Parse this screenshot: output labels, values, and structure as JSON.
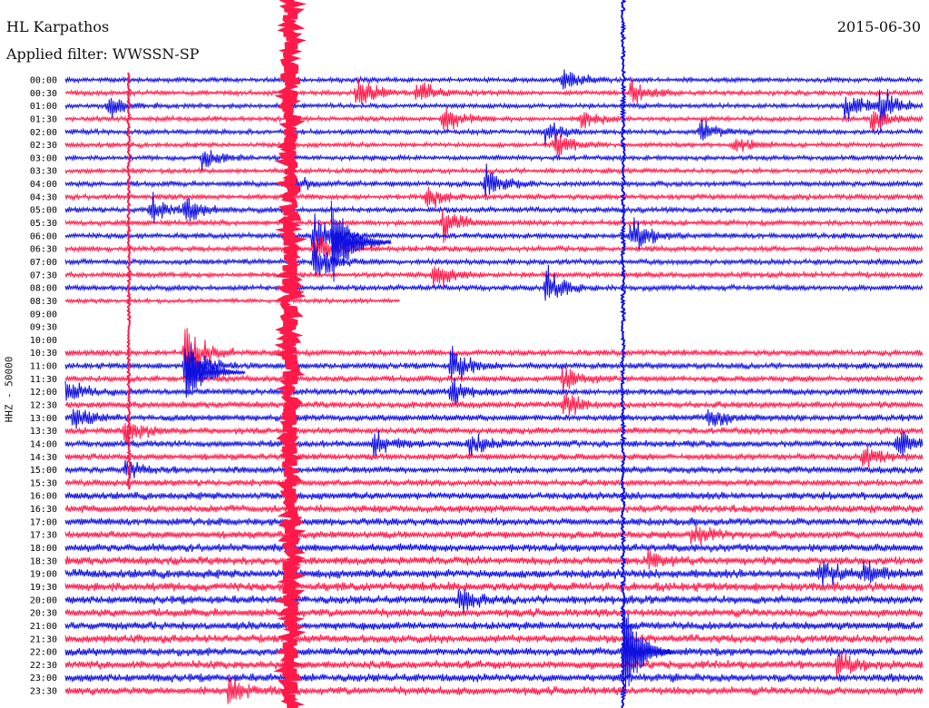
{
  "header": {
    "station": "HL Karpathos",
    "date": "2015-06-30",
    "filter": "Applied filter: WWSSN-SP",
    "channel_label": "HHZ - 50000"
  },
  "chart_data": {
    "type": "line",
    "title": "HL Karpathos",
    "subtitle": "Applied filter: WWSSN-SP",
    "ylabel": "HHZ - 50000",
    "xlabel": "",
    "colors": [
      "#1010e0",
      "#ff1a4a"
    ],
    "color_rule": "rows alternate blue (even index) and red (odd index), starting blue at 00:00",
    "row_labels": [
      "00:00",
      "00:30",
      "01:00",
      "01:30",
      "02:00",
      "02:30",
      "03:00",
      "03:30",
      "04:00",
      "04:30",
      "05:00",
      "05:30",
      "06:00",
      "06:30",
      "07:00",
      "07:30",
      "08:00",
      "08:30",
      "09:00",
      "09:30",
      "10:00",
      "10:30",
      "11:00",
      "11:30",
      "12:00",
      "12:30",
      "13:00",
      "13:30",
      "14:00",
      "14:30",
      "15:00",
      "15:30",
      "16:00",
      "16:30",
      "17:00",
      "17:30",
      "18:00",
      "18:30",
      "19:00",
      "19:30",
      "20:00",
      "20:30",
      "21:00",
      "21:30",
      "22:00",
      "22:30",
      "23:00",
      "23:30"
    ],
    "trace_extent": [
      1,
      1,
      1,
      1,
      1,
      1,
      1,
      1,
      1,
      1,
      1,
      1,
      1,
      1,
      1,
      1,
      1,
      0.39,
      0,
      0,
      0.08,
      1,
      1,
      1,
      1,
      1,
      1,
      1,
      1,
      1,
      1,
      1,
      1,
      1,
      1,
      1,
      1,
      1,
      1,
      1,
      1,
      1,
      1,
      1,
      1,
      1,
      1,
      1
    ],
    "trace_start": [
      0,
      0,
      0,
      0,
      0,
      0,
      0,
      0,
      0,
      0,
      0,
      0,
      0,
      0,
      0,
      0,
      0,
      0,
      0,
      0,
      0.92,
      0,
      0,
      0,
      0,
      0,
      0,
      0,
      0,
      0,
      0,
      0,
      0,
      0,
      0,
      0,
      0,
      0,
      0,
      0,
      0,
      0,
      0,
      0,
      0,
      0,
      0,
      0
    ],
    "noise_level": [
      0.22,
      0.22,
      0.22,
      0.22,
      0.22,
      0.22,
      0.22,
      0.22,
      0.25,
      0.25,
      0.25,
      0.25,
      0.25,
      0.25,
      0.25,
      0.25,
      0.25,
      0.2,
      0,
      0,
      0.12,
      0.28,
      0.28,
      0.28,
      0.3,
      0.3,
      0.3,
      0.3,
      0.3,
      0.3,
      0.3,
      0.3,
      0.35,
      0.35,
      0.35,
      0.35,
      0.38,
      0.38,
      0.42,
      0.42,
      0.38,
      0.38,
      0.38,
      0.38,
      0.38,
      0.38,
      0.38,
      0.38
    ],
    "events": [
      {
        "row": 1,
        "at": 0.34,
        "amp": 1.6
      },
      {
        "row": 1,
        "at": 0.41,
        "amp": 1.2
      },
      {
        "row": 1,
        "at": 0.66,
        "amp": 1.5
      },
      {
        "row": 0,
        "at": 0.58,
        "amp": 1.2
      },
      {
        "row": 2,
        "at": 0.05,
        "amp": 1.3
      },
      {
        "row": 2,
        "at": 0.91,
        "amp": 1.8
      },
      {
        "row": 2,
        "at": 0.95,
        "amp": 2.0
      },
      {
        "row": 3,
        "at": 0.44,
        "amp": 1.4
      },
      {
        "row": 3,
        "at": 0.6,
        "amp": 1.0
      },
      {
        "row": 3,
        "at": 0.94,
        "amp": 1.2
      },
      {
        "row": 4,
        "at": 0.56,
        "amp": 1.3
      },
      {
        "row": 4,
        "at": 0.74,
        "amp": 1.1
      },
      {
        "row": 5,
        "at": 0.57,
        "amp": 1.3
      },
      {
        "row": 5,
        "at": 0.78,
        "amp": 1.0
      },
      {
        "row": 6,
        "at": 0.16,
        "amp": 1.3
      },
      {
        "row": 8,
        "at": 0.26,
        "amp": 1.2
      },
      {
        "row": 8,
        "at": 0.49,
        "amp": 1.6
      },
      {
        "row": 9,
        "at": 0.42,
        "amp": 1.2
      },
      {
        "row": 10,
        "at": 0.1,
        "amp": 1.4
      },
      {
        "row": 10,
        "at": 0.14,
        "amp": 1.2
      },
      {
        "row": 11,
        "at": 0.44,
        "amp": 1.5
      },
      {
        "row": 12,
        "at": 0.29,
        "amp": 2.4
      },
      {
        "row": 12,
        "at": 0.66,
        "amp": 1.8
      },
      {
        "row": 13,
        "at": 0.29,
        "amp": 1.8
      },
      {
        "row": 14,
        "at": 0.29,
        "amp": 1.8
      },
      {
        "row": 15,
        "at": 0.43,
        "amp": 1.4
      },
      {
        "row": 16,
        "at": 0.56,
        "amp": 2.0
      },
      {
        "row": 21,
        "at": 0.14,
        "amp": 3.0
      },
      {
        "row": 22,
        "at": 0.14,
        "amp": 2.6
      },
      {
        "row": 22,
        "at": 0.45,
        "amp": 1.8
      },
      {
        "row": 23,
        "at": 0.58,
        "amp": 1.4
      },
      {
        "row": 24,
        "at": 0.45,
        "amp": 1.4
      },
      {
        "row": 24,
        "at": 0.0,
        "amp": 1.3
      },
      {
        "row": 25,
        "at": 0.58,
        "amp": 1.2
      },
      {
        "row": 26,
        "at": 0.01,
        "amp": 1.3
      },
      {
        "row": 26,
        "at": 0.75,
        "amp": 1.0
      },
      {
        "row": 27,
        "at": 0.07,
        "amp": 1.5
      },
      {
        "row": 28,
        "at": 0.36,
        "amp": 1.3
      },
      {
        "row": 28,
        "at": 0.47,
        "amp": 1.2
      },
      {
        "row": 28,
        "at": 0.97,
        "amp": 1.2
      },
      {
        "row": 29,
        "at": 0.93,
        "amp": 1.4
      },
      {
        "row": 30,
        "at": 0.07,
        "amp": 1.0
      },
      {
        "row": 35,
        "at": 0.73,
        "amp": 1.1
      },
      {
        "row": 37,
        "at": 0.68,
        "amp": 1.0
      },
      {
        "row": 38,
        "at": 0.88,
        "amp": 1.3
      },
      {
        "row": 38,
        "at": 0.93,
        "amp": 1.1
      },
      {
        "row": 40,
        "at": 0.46,
        "amp": 1.2
      },
      {
        "row": 45,
        "at": 0.9,
        "amp": 1.2
      },
      {
        "row": 47,
        "at": 0.19,
        "amp": 1.3
      }
    ],
    "vertical_streaks": [
      {
        "at": 0.262,
        "row_from": 0,
        "row_to": 47,
        "color": "#ff1a4a",
        "width": 0.018
      },
      {
        "at": 0.65,
        "row_from": 0,
        "row_to": 47,
        "color": "#1010e0",
        "width": 0.004
      },
      {
        "at": 0.074,
        "row_from": 0,
        "row_to": 16,
        "color": "#ff1a4a",
        "width": 0.003
      }
    ],
    "swarms": [
      {
        "at": 0.31,
        "row_from": 10,
        "row_to": 15,
        "color": "#1010e0",
        "amp": 3.2,
        "length": 0.07
      },
      {
        "at": 0.14,
        "row_from": 21,
        "row_to": 24,
        "color": "#1010e0",
        "amp": 3.0,
        "length": 0.07
      },
      {
        "at": 0.65,
        "row_from": 41,
        "row_to": 47,
        "color": "#1010e0",
        "amp": 2.6,
        "length": 0.06
      }
    ]
  }
}
